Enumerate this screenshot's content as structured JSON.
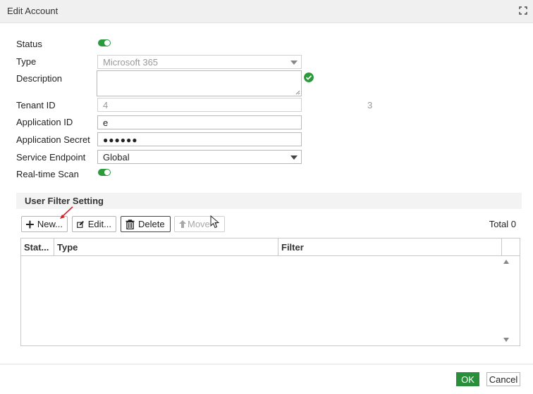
{
  "dialog": {
    "title": "Edit Account",
    "expand_icon": "expand-icon"
  },
  "form": {
    "status": {
      "label": "Status",
      "enabled": true
    },
    "type": {
      "label": "Type",
      "value": "Microsoft 365"
    },
    "description": {
      "label": "Description",
      "value": "",
      "valid_icon": "checkmark-circle-icon"
    },
    "tenant_id": {
      "label": "Tenant ID",
      "value_left": "4",
      "value_right": "3"
    },
    "application_id": {
      "label": "Application ID",
      "value": "e"
    },
    "application_secret": {
      "label": "Application Secret",
      "value": "●●●●●●"
    },
    "service_endpoint": {
      "label": "Service Endpoint",
      "value": "Global"
    },
    "realtime_scan": {
      "label": "Real-time Scan",
      "enabled": true
    }
  },
  "user_filter": {
    "section_title": "User Filter Setting",
    "toolbar": {
      "new_label": "New...",
      "edit_label": "Edit...",
      "delete_label": "Delete",
      "move_label": "Move"
    },
    "total_label": "Total 0",
    "columns": [
      "Stat...",
      "Type",
      "Filter"
    ],
    "rows": []
  },
  "footer": {
    "ok_label": "OK",
    "cancel_label": "Cancel"
  },
  "colors": {
    "accent_green": "#2a9a3a",
    "ok_button": "#2a8f3a",
    "titlebar": "#f0f0f0"
  }
}
